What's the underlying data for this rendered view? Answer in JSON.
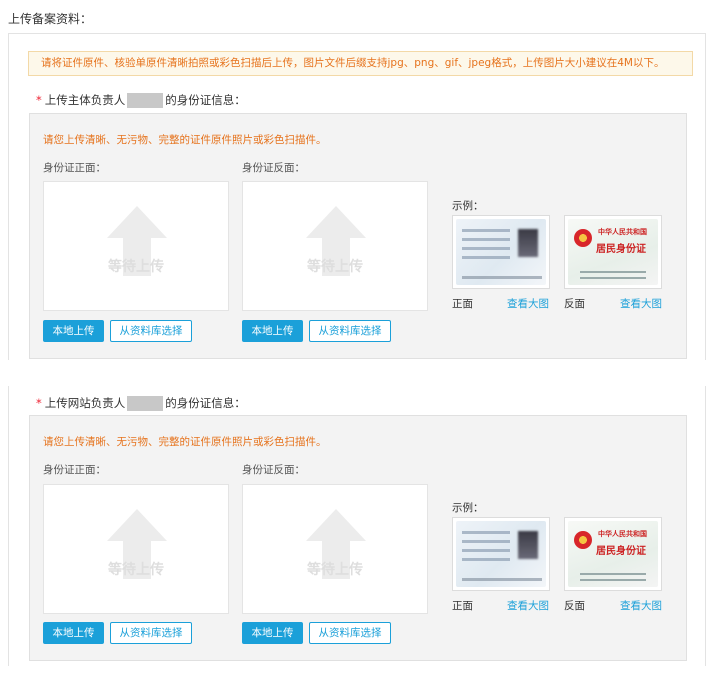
{
  "page_title": "上传备案资料：",
  "notice": "请将证件原件、核验单原件清晰拍照或彩色扫描后上传，图片文件后缀支持jpg、png、gif、jpeg格式，上传图片大小建议在4M以下。",
  "sections": [
    {
      "star": "*",
      "title_prefix": "上传主体负责人",
      "title_suffix": "的身份证信息：",
      "hint": "请您上传清晰、无污物、完整的证件原件照片或彩色扫描件。",
      "front_label": "身份证正面：",
      "back_label": "身份证反面：",
      "placeholder": "等待上传",
      "local_button": "本地上传",
      "library_button": "从资料库选择",
      "example_label": "示例：",
      "front_text": "正面",
      "back_text": "反面",
      "view_large": "查看大图"
    },
    {
      "star": "*",
      "title_prefix": "上传网站负责人",
      "title_suffix": "的身份证信息：",
      "hint": "请您上传清晰、无污物、完整的证件原件照片或彩色扫描件。",
      "front_label": "身份证正面：",
      "back_label": "身份证反面：",
      "placeholder": "等待上传",
      "local_button": "本地上传",
      "library_button": "从资料库选择",
      "example_label": "示例：",
      "front_text": "正面",
      "back_text": "反面",
      "view_large": "查看大图"
    }
  ],
  "sample_card_back": {
    "country": "中华人民共和国",
    "title": "居民身份证"
  },
  "colors": {
    "accent": "#1ba0d9",
    "warning": "#e6731d",
    "required": "#ee2233"
  }
}
